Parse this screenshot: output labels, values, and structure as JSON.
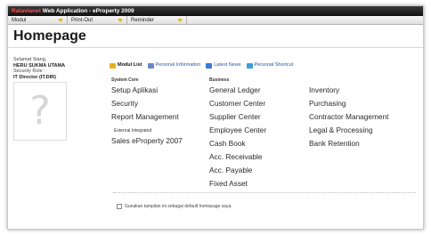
{
  "titlebar": {
    "brand": "Ratavianet",
    "title": "Web Application - eProperty 2009"
  },
  "menu": [
    {
      "label": "Modul"
    },
    {
      "label": "Print-Out"
    },
    {
      "label": "Reminder"
    }
  ],
  "page_title": "Homepage",
  "user": {
    "greeting": "Selamat Siang,",
    "name": "HERU SUKMA UTAMA",
    "role_label": "Security Role :",
    "role": "IT Director (IT.DIR)"
  },
  "tabs": [
    {
      "label": "Modul List",
      "icon": "folder-icon",
      "color": "#e8b020",
      "active": true
    },
    {
      "label": "Personal Information",
      "icon": "person-icon",
      "color": "#6a88c8",
      "active": false
    },
    {
      "label": "Latest News",
      "icon": "news-icon",
      "color": "#3a7bd5",
      "active": false
    },
    {
      "label": "Personal Shortcut",
      "icon": "shortcut-icon",
      "color": "#3aa0d5",
      "active": false
    }
  ],
  "columns": {
    "system_core_header": "System Core",
    "business_header": "Business",
    "system_core": [
      "Setup Aplikasi",
      "Security",
      "Report Management"
    ],
    "external_label": "External Integrated",
    "external_item": "Sales eProperty 2007",
    "business_mid": [
      "General Ledger",
      "Customer Center",
      "Supplier Center",
      "Employee Center",
      "Cash Book",
      "Acc. Receivable",
      "Acc. Payable",
      "Fixed Asset"
    ],
    "business_right": [
      "Inventory",
      "Purchasing",
      "Contractor Management",
      "Legal & Processing",
      "Bank Retention"
    ]
  },
  "default_homepage_label": "Gunakan tampilan ini sebagai default homepage saya."
}
